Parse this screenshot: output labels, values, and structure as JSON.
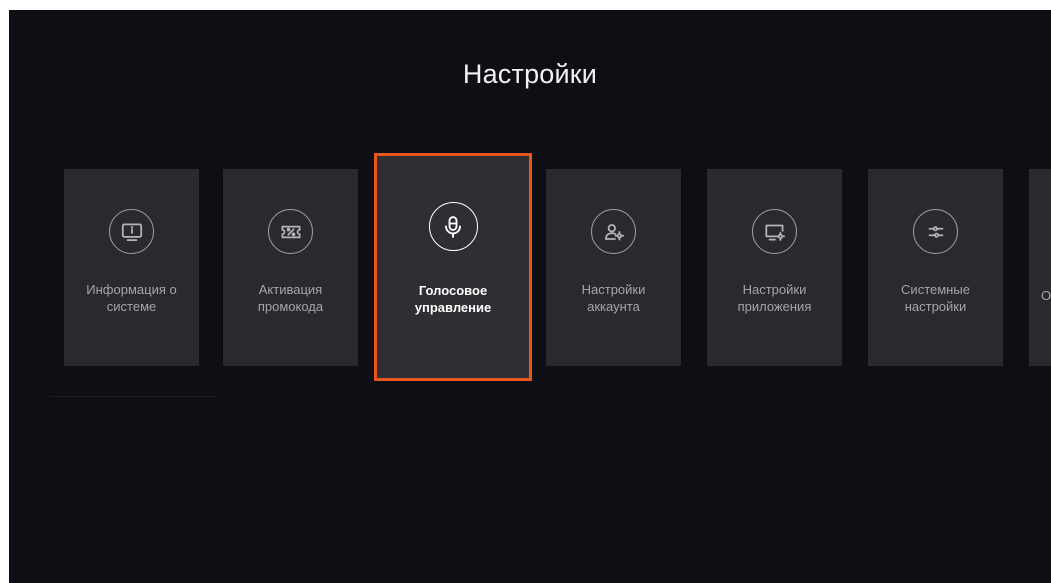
{
  "header": {
    "title": "Настройки"
  },
  "tiles": [
    {
      "label": "Информация о\nсистеме",
      "icon": "info-tv-icon",
      "focused": false
    },
    {
      "label": "Активация\nпромокода",
      "icon": "promo-ticket-icon",
      "focused": false
    },
    {
      "label": "Голосовое\nуправление",
      "icon": "microphone-icon",
      "focused": true
    },
    {
      "label": "Настройки\nаккаунта",
      "icon": "account-settings-icon",
      "focused": false
    },
    {
      "label": "Настройки\nприложения",
      "icon": "app-settings-icon",
      "focused": false
    },
    {
      "label": "Системные\nнастройки",
      "icon": "sliders-icon",
      "focused": false
    },
    {
      "label": "О",
      "icon": "",
      "focused": false
    }
  ],
  "colors": {
    "background": "#0f0e14",
    "tile": "#2a2a2e",
    "focus_border": "#e8561e",
    "title_text": "#f2f2f2",
    "label_text": "#a4a4aa"
  }
}
